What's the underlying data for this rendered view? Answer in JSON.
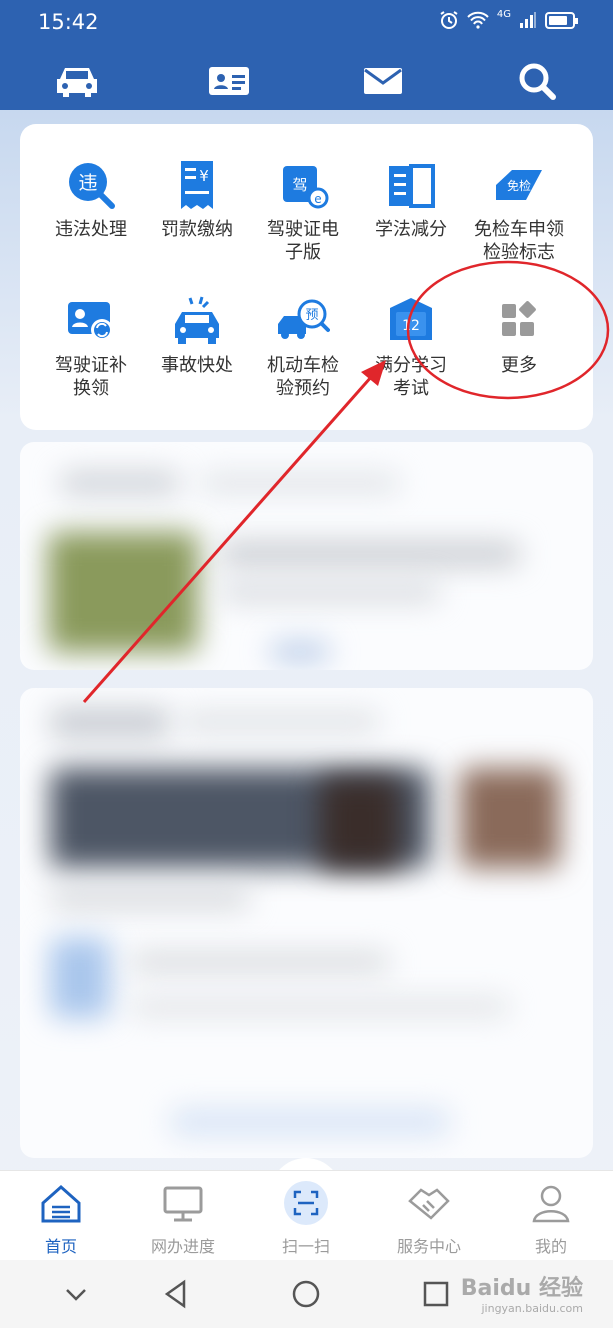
{
  "status_bar": {
    "time": "15:42",
    "network": "4G"
  },
  "top_nav": {
    "icons": [
      "car-icon",
      "id-card-icon",
      "mail-icon",
      "search-icon"
    ]
  },
  "services": [
    {
      "label": "违法处理",
      "icon": "violation-search-icon",
      "icon_text": "违"
    },
    {
      "label": "罚款缴纳",
      "icon": "fine-receipt-icon",
      "icon_text": "¥"
    },
    {
      "label": "驾驶证电\n子版",
      "icon": "e-license-icon",
      "icon_text": "驾"
    },
    {
      "label": "学法减分",
      "icon": "study-book-icon"
    },
    {
      "label": "免检车申领\n检验标志",
      "icon": "exempt-inspection-icon",
      "icon_text": "免检"
    },
    {
      "label": "驾驶证补\n换领",
      "icon": "license-renew-icon"
    },
    {
      "label": "事故快处",
      "icon": "accident-icon"
    },
    {
      "label": "机动车检\n验预约",
      "icon": "inspection-booking-icon",
      "icon_text": "预"
    },
    {
      "label": "满分学习\n考试",
      "icon": "full-score-exam-icon",
      "icon_text": "12"
    },
    {
      "label": "更多",
      "icon": "more-grid-icon"
    }
  ],
  "bottom_tabs": [
    {
      "label": "首页",
      "icon": "home-icon",
      "active": true
    },
    {
      "label": "网办进度",
      "icon": "monitor-icon",
      "active": false
    },
    {
      "label": "扫一扫",
      "icon": "scan-icon",
      "active": false
    },
    {
      "label": "服务中心",
      "icon": "handshake-icon",
      "active": false
    },
    {
      "label": "我的",
      "icon": "user-icon",
      "active": false
    }
  ],
  "watermark": {
    "brand": "Baidu 经验",
    "url": "jingyan.baidu.com"
  },
  "colors": {
    "primary": "#2d62b1",
    "accent_blue": "#1e7be0",
    "annotation_red": "#e0262b"
  }
}
